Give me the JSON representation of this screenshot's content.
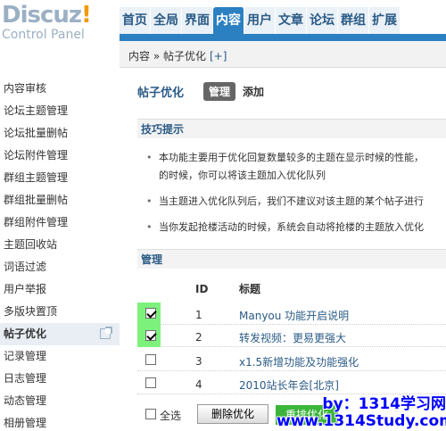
{
  "logo": {
    "main": "Discuz",
    "bang": "!",
    "sub": "Control Panel"
  },
  "nav": [
    "首页",
    "全局",
    "界面",
    "内容",
    "用户",
    "文章",
    "论坛",
    "群组",
    "扩展"
  ],
  "nav_active": "内容",
  "breadcrumb": {
    "path": "内容 » 帖子优化",
    "add": "[+]"
  },
  "sidebar": {
    "items": [
      "内容审核",
      "论坛主题管理",
      "论坛批量删帖",
      "论坛附件管理",
      "群组主题管理",
      "群组批量删帖",
      "群组附件管理",
      "主题回收站",
      "词语过滤",
      "用户举报",
      "多版块置顶",
      "帖子优化",
      "记录管理",
      "日志管理",
      "动态管理",
      "相册管理"
    ],
    "active": "帖子优化"
  },
  "page": {
    "title": "帖子优化",
    "tab_manage": "管理",
    "tab_add": "添加"
  },
  "tips": {
    "heading": "技巧提示",
    "items": [
      "本功能主要用于优化回复数量较多的主题在显示时候的性能，",
      "的时候，你可以将该主题加入优化队列",
      "当主题进入优化队列后，我们不建议对该主题的某个帖子进行",
      "当你发起抢楼活动的时候，系统会自动将抢楼的主题放入优化"
    ]
  },
  "manage": {
    "heading": "管理",
    "col_id": "ID",
    "col_title": "标题",
    "rows": [
      {
        "id": "1",
        "title": "Manyou 功能开启说明",
        "checked": true
      },
      {
        "id": "2",
        "title": "转发视频：更易更强大",
        "checked": true
      },
      {
        "id": "3",
        "title": "x1.5新增功能及功能强化",
        "checked": false
      },
      {
        "id": "4",
        "title": "2010站长年会[北京]",
        "checked": false
      }
    ],
    "select_all": "全选",
    "remove_button": "删除优化",
    "green_button": "重排优化"
  },
  "watermark": {
    "line1": "by：1314学习网",
    "line2": "www.1314Study.com"
  },
  "colors": {
    "accent": "#2b80c2",
    "highlight": "#7cf27c",
    "watermark": "#0000ff"
  }
}
